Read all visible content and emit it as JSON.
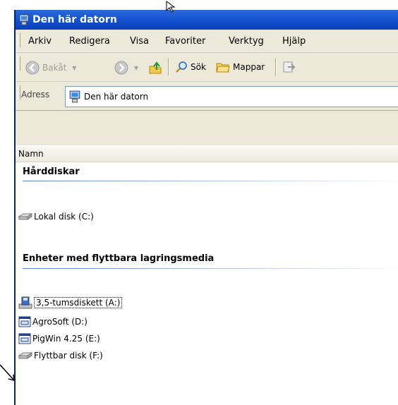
{
  "window": {
    "title": "Den här datorn"
  },
  "menu": [
    "Arkiv",
    "Redigera",
    "Visa",
    "Favoriter",
    "Verktyg",
    "Hjälp"
  ],
  "toolbar": {
    "back": "Bakåt",
    "search": "Sök",
    "folders": "Mappar"
  },
  "address": {
    "label": "Adress",
    "value": "Den här datorn"
  },
  "list": {
    "column_name": "Namn",
    "group_hard_disks": "Hårddiskar",
    "local_disk": "Lokal disk (C:)",
    "group_removable": "Enheter med flyttbara lagringsmedia",
    "floppy": "3,5-tumsdiskett (A:)",
    "agrosoft": "AgroSoft (D:)",
    "pigwin": "PigWin 4.25 (E:)",
    "removable": "Flyttbar disk (F:)"
  },
  "icons": [
    "computer-icon",
    "back-icon",
    "forward-icon",
    "up-folder-icon",
    "search-icon",
    "folders-icon",
    "move-to-icon",
    "hard-drive-icon",
    "floppy-icon",
    "cd-drive-icon",
    "removable-drive-icon"
  ]
}
